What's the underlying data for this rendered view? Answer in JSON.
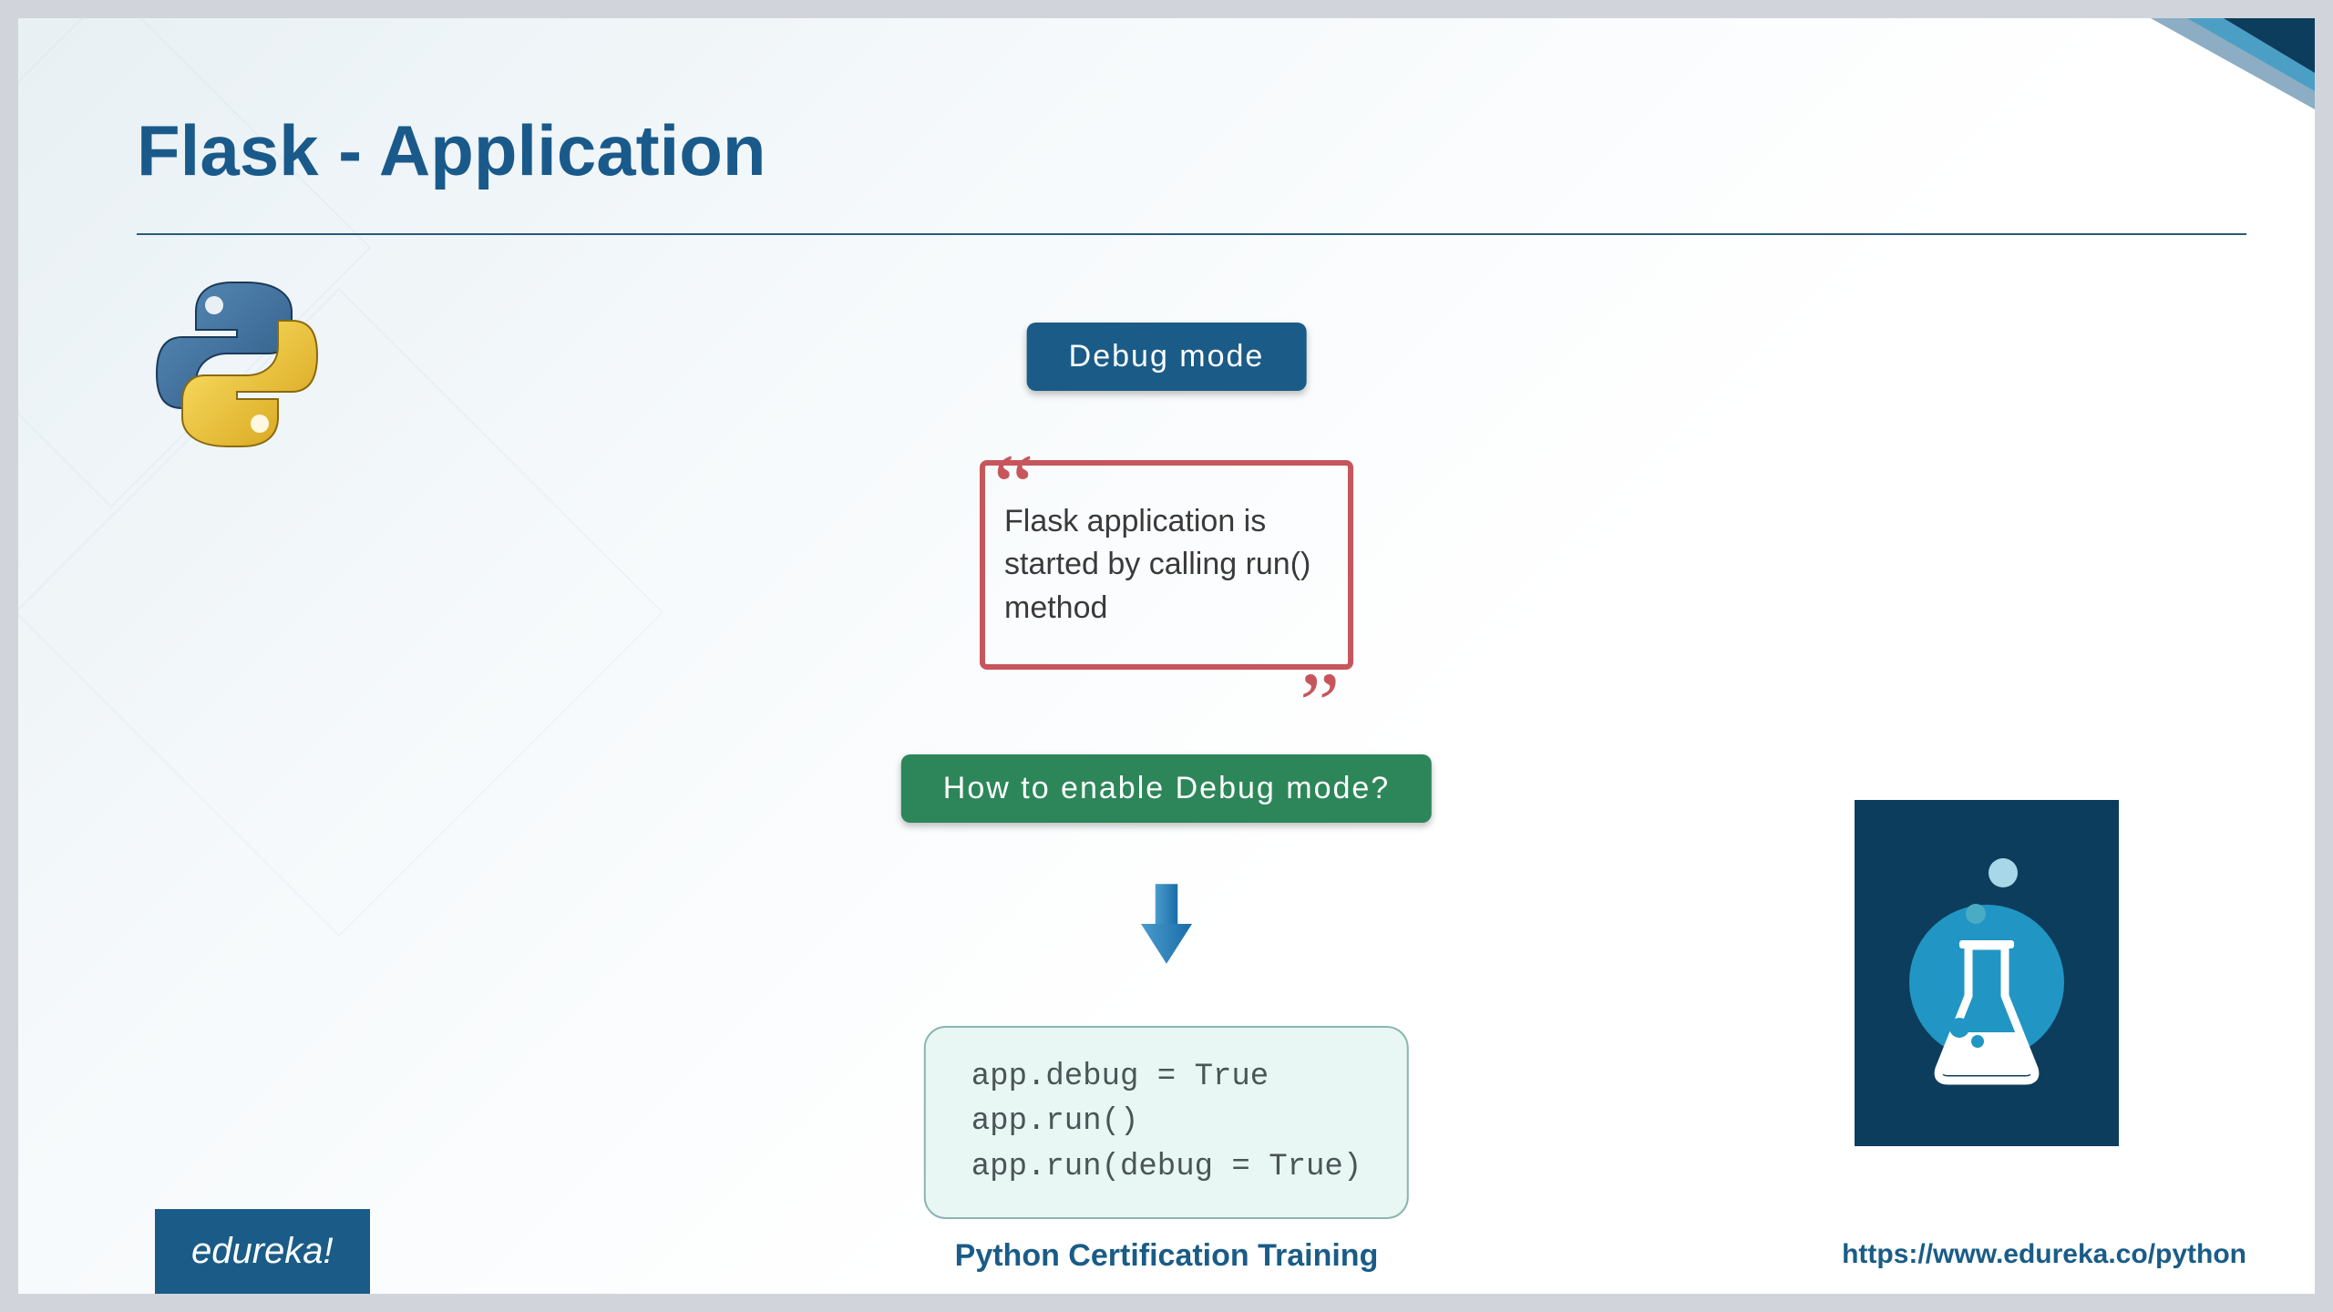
{
  "title": "Flask - Application",
  "badge_blue": "Debug mode",
  "quote": "Flask application is started by calling run() method",
  "badge_green": "How to enable Debug mode?",
  "code": "app.debug = True\napp.run()\napp.run(debug = True)",
  "footer": {
    "brand": "edureka!",
    "center": "Python Certification Training",
    "url": "https://www.edureka.co/python"
  }
}
